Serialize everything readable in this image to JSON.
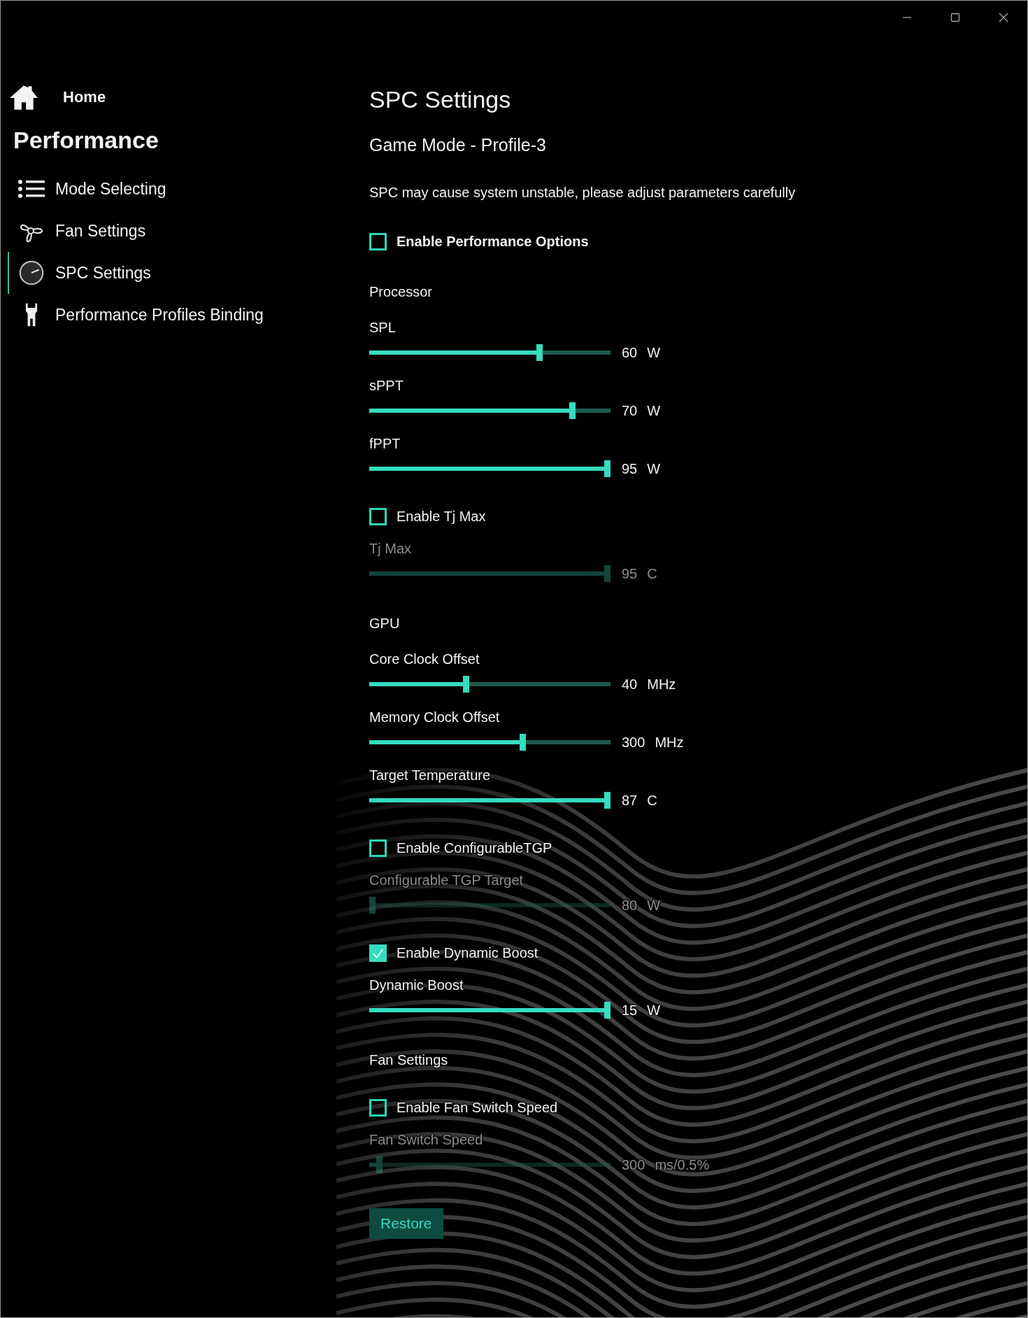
{
  "sidebar": {
    "home": "Home",
    "section": "Performance",
    "items": [
      {
        "label": "Mode Selecting",
        "selected": false
      },
      {
        "label": "Fan Settings",
        "selected": false
      },
      {
        "label": "SPC Settings",
        "selected": true
      },
      {
        "label": "Performance Profiles Binding",
        "selected": false
      }
    ]
  },
  "page": {
    "title": "SPC Settings",
    "subtitle": "Game Mode - Profile-3",
    "warning": "SPC may cause system unstable, please adjust parameters carefully"
  },
  "settings": [
    {
      "kind": "master_checkbox",
      "label": "Enable Performance Options",
      "checked": false
    },
    {
      "kind": "heading",
      "label": "Processor"
    },
    {
      "kind": "slider",
      "label": "SPL",
      "level": 0.71,
      "value": "60",
      "unit": "W",
      "disabled": false
    },
    {
      "kind": "slider",
      "label": "sPPT",
      "level": 0.85,
      "value": "70",
      "unit": "W",
      "disabled": false
    },
    {
      "kind": "slider",
      "label": "fPPT",
      "level": 1.0,
      "value": "95",
      "unit": "W",
      "disabled": false
    },
    {
      "kind": "checkbox",
      "label": "Enable Tj Max",
      "checked": false
    },
    {
      "kind": "slider",
      "label": "Tj Max",
      "level": 1.0,
      "value": "95",
      "unit": "C",
      "disabled": true
    },
    {
      "kind": "heading",
      "label": "GPU"
    },
    {
      "kind": "slider",
      "label": "Core Clock Offset",
      "level": 0.4,
      "value": "40",
      "unit": "MHz",
      "disabled": false
    },
    {
      "kind": "slider",
      "label": "Memory Clock Offset",
      "level": 0.64,
      "value": "300",
      "unit": "MHz",
      "disabled": false
    },
    {
      "kind": "slider",
      "label": "Target Temperature",
      "level": 1.0,
      "value": "87",
      "unit": "C",
      "disabled": false
    },
    {
      "kind": "checkbox",
      "label": "Enable ConfigurableTGP",
      "checked": false
    },
    {
      "kind": "slider",
      "label": "Configurable TGP Target",
      "level": 0.0,
      "value": "80",
      "unit": "W",
      "disabled": true
    },
    {
      "kind": "checkbox",
      "label": "Enable Dynamic Boost",
      "checked": true
    },
    {
      "kind": "slider",
      "label": "Dynamic Boost",
      "level": 1.0,
      "value": "15",
      "unit": "W",
      "disabled": false
    },
    {
      "kind": "heading",
      "label": "Fan Settings"
    },
    {
      "kind": "checkbox",
      "label": "Enable Fan Switch Speed",
      "checked": false
    },
    {
      "kind": "slider",
      "label": "Fan Switch Speed",
      "level": 0.03,
      "value": "300",
      "unit": "ms/0.5%",
      "disabled": true
    }
  ],
  "buttons": [
    {
      "label": "Restore"
    }
  ]
}
